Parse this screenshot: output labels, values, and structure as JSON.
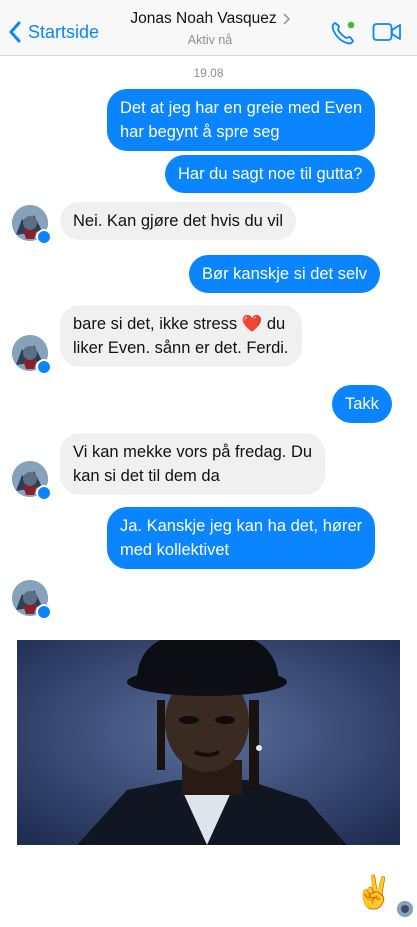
{
  "header": {
    "back_label": "Startside",
    "contact_name": "Jonas Noah Vasquez",
    "status": "Aktiv nå",
    "accent": "#0a84ff",
    "icons": [
      "chevron-left-icon",
      "chevron-right-icon",
      "phone-icon",
      "video-camera-icon"
    ]
  },
  "thread": {
    "date": "19.08",
    "messages": [
      {
        "dir": "out",
        "lines": [
          "Det at jeg har en greie med Even",
          "har begynt å spre seg"
        ]
      },
      {
        "dir": "out",
        "lines": [
          "Har du sagt noe til gutta?"
        ]
      },
      {
        "dir": "in",
        "lines": [
          "Nei. Kan gjøre det hvis du vil"
        ]
      },
      {
        "dir": "out",
        "lines": [
          "Bør kanskje si det selv"
        ]
      },
      {
        "dir": "in",
        "lines": [
          "bare si det, ikke stress ❤️ du",
          "liker Even. sånn er det. Ferdi."
        ]
      },
      {
        "dir": "out",
        "lines": [
          "Takk"
        ]
      },
      {
        "dir": "in",
        "lines": [
          "Vi kan mekke vors på fredag. Du",
          "kan si det til dem da"
        ]
      },
      {
        "dir": "out",
        "lines": [
          "Ja. Kanskje jeg kan ha det, hører",
          "med kollektivet"
        ]
      },
      {
        "dir": "in",
        "type": "image"
      },
      {
        "dir": "out",
        "type": "emoji",
        "text": "✌️"
      }
    ]
  },
  "colors": {
    "outgoing_bubble": "#0a84ff",
    "incoming_bubble": "#f1f0f0",
    "timestamp": "#8e8e93"
  }
}
